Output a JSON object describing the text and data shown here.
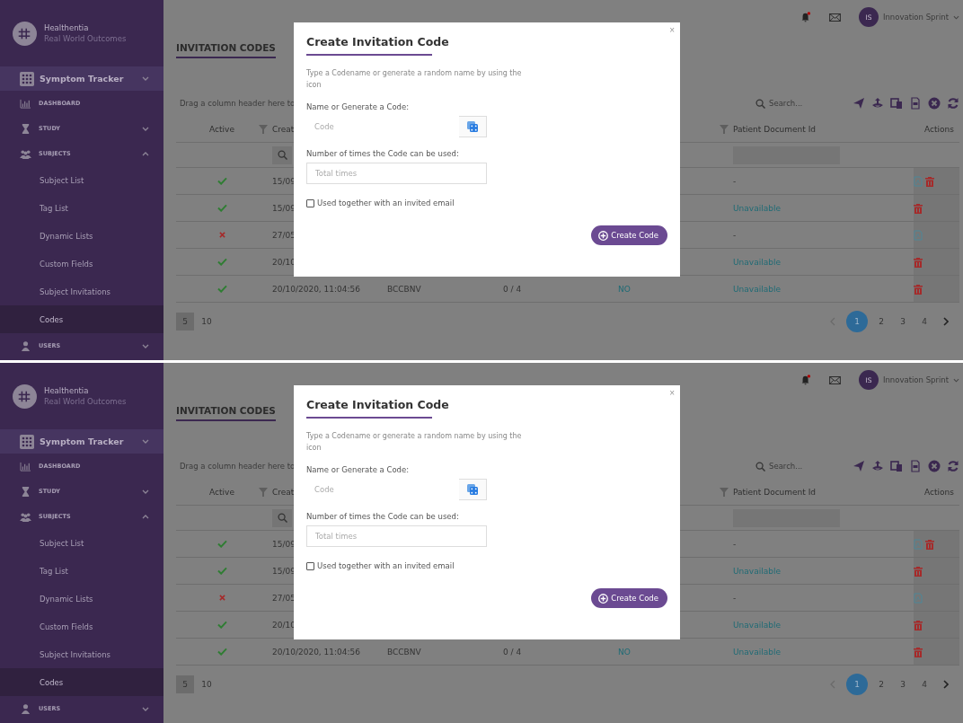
{
  "screens": [
    {
      "sidebar": {
        "brand": "Healthentia",
        "tagline": "Real World Outcomes",
        "app_switcher": {
          "label": "Symptom Tracker",
          "expanded": false
        },
        "items": [
          {
            "label": "DASHBOARD"
          },
          {
            "label": "STUDY",
            "expanded": false
          },
          {
            "label": "SUBJECTS",
            "expanded": true,
            "children": [
              {
                "label": "Subject List",
                "selected": false
              },
              {
                "label": "Tag List",
                "selected": false
              },
              {
                "label": "Dynamic Lists",
                "selected": false
              },
              {
                "label": "Custom Fields",
                "selected": false
              },
              {
                "label": "Subject Invitations",
                "selected": false
              },
              {
                "label": "Codes",
                "selected": true
              }
            ]
          },
          {
            "label": "USERS",
            "expanded": false
          }
        ]
      },
      "top_bar": {
        "notification_dot": true,
        "user_initials": "IS",
        "user_name": "Innovation Sprint"
      },
      "page_title": "INVITATION CODES",
      "toolbar": {
        "group_hint": "Drag a column header here to",
        "search_placeholder": "Search..."
      },
      "table": {
        "columns": [
          {
            "label": "Active"
          },
          {
            "label": "Creat"
          },
          {
            "label": "Patient Document Id"
          },
          {
            "label": "Actions"
          }
        ],
        "rows": [
          {
            "active": true,
            "created": "15/09",
            "patient_document_id": {
              "text": "-",
              "link": false
            },
            "has_pdf": true,
            "deletable": true
          },
          {
            "active": true,
            "created": "15/09",
            "patient_document_id": {
              "text": "Unavailable",
              "link": true
            },
            "has_pdf": false,
            "deletable": true
          },
          {
            "active": false,
            "created": "27/05",
            "patient_document_id": {
              "text": "-",
              "link": false
            },
            "has_pdf": true,
            "deletable": false
          },
          {
            "active": true,
            "created": "20/10",
            "patient_document_id": {
              "text": "Unavailable",
              "link": true
            },
            "has_pdf": false,
            "deletable": true
          },
          {
            "active": true,
            "created": "20/10/2020, 11:04:56",
            "code": "BCCBNV",
            "usage": "0 / 4",
            "invited": "NO",
            "patient_document_id": {
              "text": "Unavailable",
              "link": true
            },
            "has_pdf": false,
            "deletable": true
          }
        ]
      },
      "pagination": {
        "page_sizes": [
          {
            "label": "5",
            "selected": true
          },
          {
            "label": "10",
            "selected": false
          }
        ],
        "pages": [
          {
            "label": "1",
            "selected": true
          },
          {
            "label": "2",
            "selected": false
          },
          {
            "label": "3",
            "selected": false
          },
          {
            "label": "4",
            "selected": false
          }
        ]
      },
      "modal": {
        "close": "×",
        "title": "Create Invitation Code",
        "description": "Type a Codename or generate a random name by using the icon",
        "code_label": "Name or Generate a Code:",
        "code_placeholder": "Code",
        "times_label": "Number of times the Code can be used:",
        "times_placeholder": "Total times",
        "checkbox": {
          "label": "Used together with an invited email",
          "checked": false
        },
        "button": "Create Code"
      }
    },
    {
      "sidebar": {
        "brand": "Healthentia",
        "tagline": "Real World Outcomes",
        "app_switcher": {
          "label": "Symptom Tracker",
          "expanded": false
        },
        "items": [
          {
            "label": "DASHBOARD"
          },
          {
            "label": "STUDY",
            "expanded": false
          },
          {
            "label": "SUBJECTS",
            "expanded": true,
            "children": [
              {
                "label": "Subject List",
                "selected": false
              },
              {
                "label": "Tag List",
                "selected": false
              },
              {
                "label": "Dynamic Lists",
                "selected": false
              },
              {
                "label": "Custom Fields",
                "selected": false
              },
              {
                "label": "Subject Invitations",
                "selected": false
              },
              {
                "label": "Codes",
                "selected": true
              }
            ]
          },
          {
            "label": "USERS",
            "expanded": false
          }
        ]
      },
      "top_bar": {
        "notification_dot": true,
        "user_initials": "IS",
        "user_name": "Innovation Sprint"
      },
      "page_title": "INVITATION CODES",
      "toolbar": {
        "group_hint": "Drag a column header here to",
        "search_placeholder": "Search..."
      },
      "table": {
        "columns": [
          {
            "label": "Active"
          },
          {
            "label": "Creat"
          },
          {
            "label": "Patient Document Id"
          },
          {
            "label": "Actions"
          }
        ],
        "rows": [
          {
            "active": true,
            "created": "15/09",
            "patient_document_id": {
              "text": "-",
              "link": false
            },
            "has_pdf": true,
            "deletable": true
          },
          {
            "active": true,
            "created": "15/09",
            "patient_document_id": {
              "text": "Unavailable",
              "link": true
            },
            "has_pdf": false,
            "deletable": true
          },
          {
            "active": false,
            "created": "27/05",
            "patient_document_id": {
              "text": "-",
              "link": false
            },
            "has_pdf": true,
            "deletable": false
          },
          {
            "active": true,
            "created": "20/10",
            "patient_document_id": {
              "text": "Unavailable",
              "link": true
            },
            "has_pdf": false,
            "deletable": true
          },
          {
            "active": true,
            "created": "20/10/2020, 11:04:56",
            "code": "BCCBNV",
            "usage": "0 / 4",
            "invited": "NO",
            "patient_document_id": {
              "text": "Unavailable",
              "link": true
            },
            "has_pdf": false,
            "deletable": true
          }
        ]
      },
      "pagination": {
        "page_sizes": [
          {
            "label": "5",
            "selected": true
          },
          {
            "label": "10",
            "selected": false
          }
        ],
        "pages": [
          {
            "label": "1",
            "selected": true
          },
          {
            "label": "2",
            "selected": false
          },
          {
            "label": "3",
            "selected": false
          },
          {
            "label": "4",
            "selected": false
          }
        ]
      },
      "modal": {
        "close": "×",
        "title": "Create Invitation Code",
        "description": "Type a Codename or generate a random name by using the icon",
        "code_label": "Name or Generate a Code:",
        "code_placeholder": "Code",
        "times_label": "Number of times the Code can be used:",
        "times_placeholder": "Total times",
        "checkbox": {
          "label": "Used together with an invited email",
          "checked": false
        },
        "button": "Create Code"
      }
    }
  ]
}
